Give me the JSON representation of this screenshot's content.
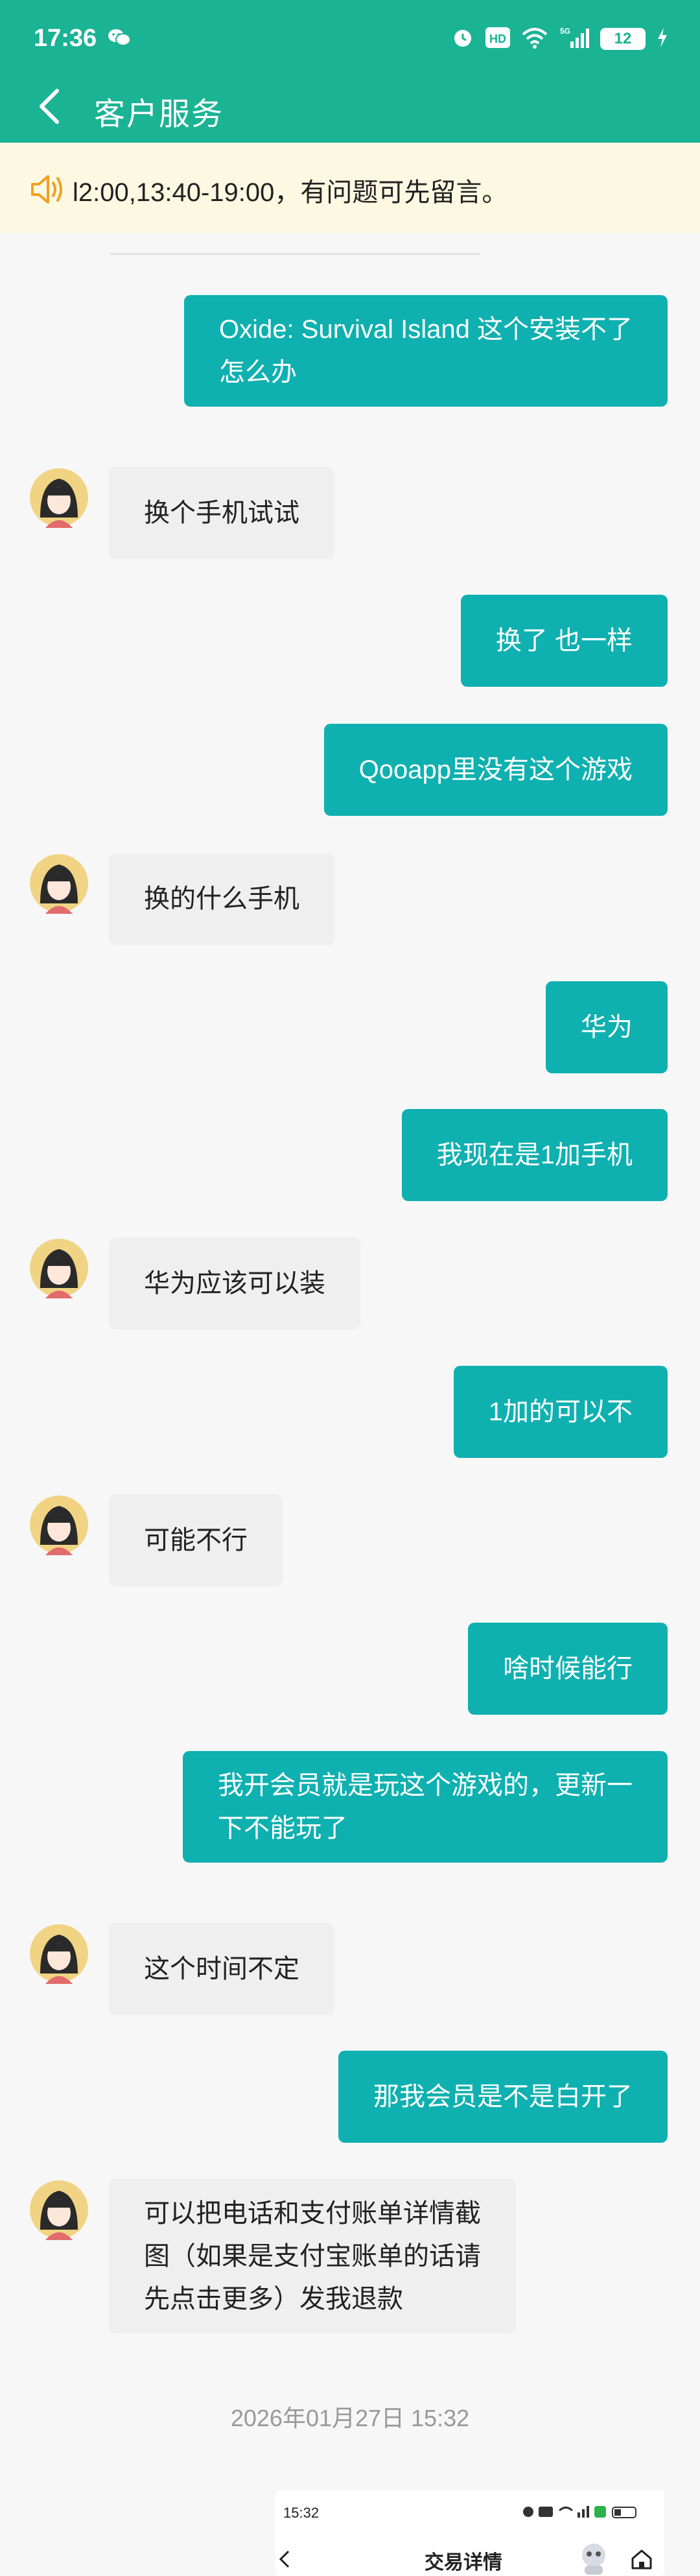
{
  "status_bar": {
    "time": "17:36",
    "network": "5G",
    "battery": "12"
  },
  "header": {
    "title": "客户服务"
  },
  "notice": {
    "text": "l2:00,13:40-19:00，有问题可先留言。"
  },
  "messages": [
    {
      "sender": "me",
      "lines": [
        "Oxide: Survival Island 这个安装不了",
        "怎么办"
      ]
    },
    {
      "sender": "agent",
      "lines": [
        "换个手机试试"
      ]
    },
    {
      "sender": "me",
      "lines": [
        "换了 也一样"
      ]
    },
    {
      "sender": "me",
      "lines": [
        "Qooapp里没有这个游戏"
      ]
    },
    {
      "sender": "agent",
      "lines": [
        "换的什么手机"
      ]
    },
    {
      "sender": "me",
      "lines": [
        "华为"
      ]
    },
    {
      "sender": "me",
      "lines": [
        "我现在是1加手机"
      ]
    },
    {
      "sender": "agent",
      "lines": [
        "华为应该可以装"
      ]
    },
    {
      "sender": "me",
      "lines": [
        "1加的可以不"
      ]
    },
    {
      "sender": "agent",
      "lines": [
        "可能不行"
      ]
    },
    {
      "sender": "me",
      "lines": [
        "啥时候能行"
      ]
    },
    {
      "sender": "me",
      "lines": [
        "我开会员就是玩这个游戏的，更新一",
        "下不能玩了"
      ]
    },
    {
      "sender": "agent",
      "lines": [
        "这个时间不定"
      ]
    },
    {
      "sender": "me",
      "lines": [
        "那我会员是不是白开了"
      ]
    },
    {
      "sender": "agent",
      "lines": [
        "可以把电话和支付账单详情截",
        "图（如果是支付宝账单的话请",
        "先点击更多）发我退款"
      ]
    }
  ],
  "timestamp": "2026年01月27日 15:32",
  "shared_screenshot": {
    "time": "15:32",
    "title": "交易详情"
  },
  "colors": {
    "brand": "#1ab394",
    "my_bubble": "#0fb0b0",
    "their_bubble": "#efefef",
    "notice_bg": "#fdf8e2"
  }
}
